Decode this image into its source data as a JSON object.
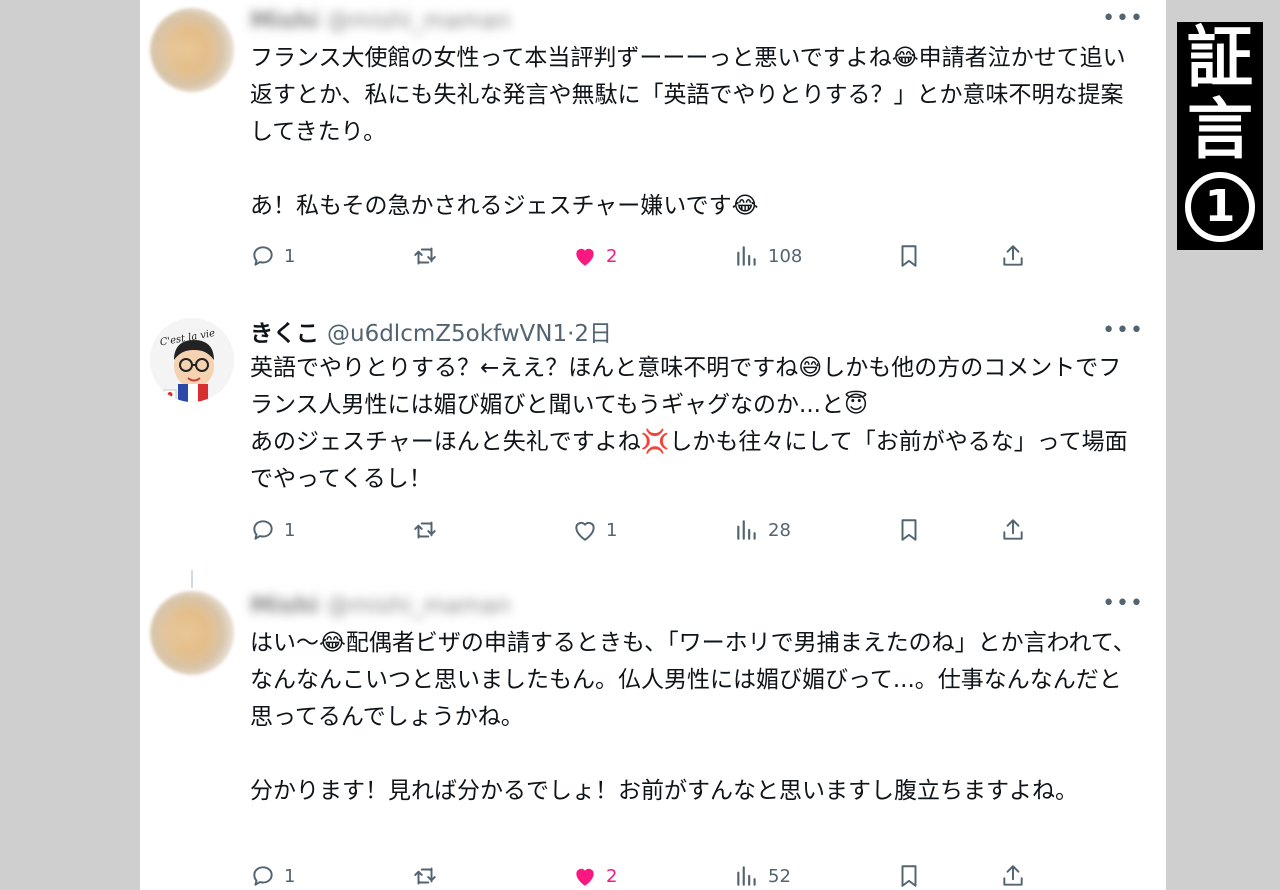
{
  "tweets": [
    {
      "name": "Mishi",
      "handle": "@mishi_maman",
      "body": "フランス大使館の女性って本当評判ずーーーっと悪いですよね😂申請者泣かせて追い返すとか、私にも失礼な発言や無駄に「英語でやりとりする？」とか意味不明な提案してきたり。\n\nあ！私もその急かされるジェスチャー嫌いです😂",
      "replies": "1",
      "retweets": "",
      "likes": "2",
      "liked": true,
      "views": "108"
    },
    {
      "name": "きくこ",
      "handle": "@u6dlcmZ5okfwVN1·2日",
      "body": "英語でやりとりする？←ええ？ほんと意味不明ですね😅しかも他の方のコメントでフランス人男性には媚び媚びと聞いてもうギャグなのか...と😇\nあのジェスチャーほんと失礼ですよね💢しかも往々にして「お前がやるな」って場面でやってくるし！",
      "replies": "1",
      "retweets": "",
      "likes": "1",
      "liked": false,
      "views": "28"
    },
    {
      "name": "Mishi",
      "handle": "@mishi_maman",
      "body": "はい〜😂配偶者ビザの申請するときも、「ワーホリで男捕まえたのね」とか言われて、なんなんこいつと思いましたもん。仏人男性には媚び媚びって...。仕事なんなんだと思ってるんでしょうかね。\n\n分かります！見れば分かるでしょ！お前がすんなと思いますし腹立ちますよね。",
      "replies": "1",
      "retweets": "",
      "likes": "2",
      "liked": true,
      "views": "52"
    }
  ],
  "stamp": {
    "line1": "証",
    "line2": "言",
    "line3": "1"
  },
  "colors": {
    "like": "#f91880",
    "muted": "#536471",
    "text": "#0f1419"
  },
  "icons": [
    "reply-icon",
    "retweet-icon",
    "heart-icon",
    "views-icon",
    "bookmark-icon",
    "share-icon",
    "more-icon"
  ]
}
